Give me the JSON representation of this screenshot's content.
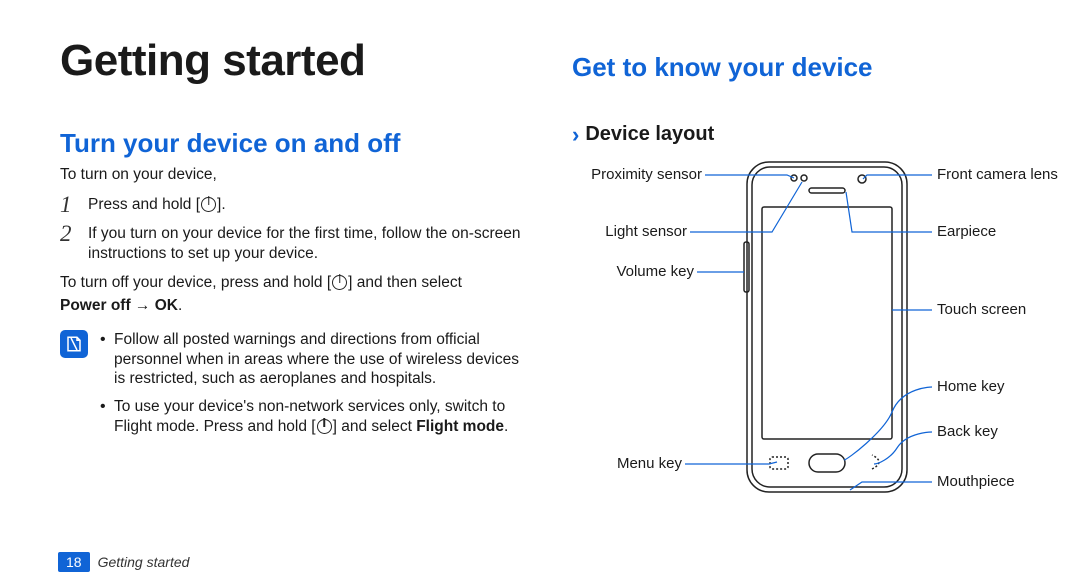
{
  "chapter_title": "Getting started",
  "left": {
    "section_title": "Turn your device on and off",
    "intro": "To turn on your device,",
    "step1": "Press and hold [",
    "step1_suffix": "].",
    "step2": "If you turn on your device for the first time, follow the on-screen instructions to set up your device.",
    "turn_off_prefix": "To turn off your device, press and hold [",
    "turn_off_suffix": "] and then select ",
    "power_off_label": "Power off → OK",
    "period": ".",
    "bullet1": "Follow all posted warnings and directions from official personnel when in areas where the use of wireless devices is restricted, such as aeroplanes and hospitals.",
    "bullet2_prefix": "To use your device's non-network services only, switch to Flight mode. Press and hold [",
    "bullet2_mid": "] and select ",
    "flight_mode": "Flight mode",
    "bullet2_end": "."
  },
  "right": {
    "section_title": "Get to know your device",
    "sub_title": "Device layout",
    "labels": {
      "proximity": "Proximity sensor",
      "light": "Light sensor",
      "volume": "Volume key",
      "menu": "Menu key",
      "front_camera": "Front camera lens",
      "earpiece": "Earpiece",
      "touch": "Touch screen",
      "home": "Home key",
      "back": "Back key",
      "mouthpiece": "Mouthpiece"
    }
  },
  "footer": {
    "page_number": "18",
    "running_title": "Getting started"
  }
}
